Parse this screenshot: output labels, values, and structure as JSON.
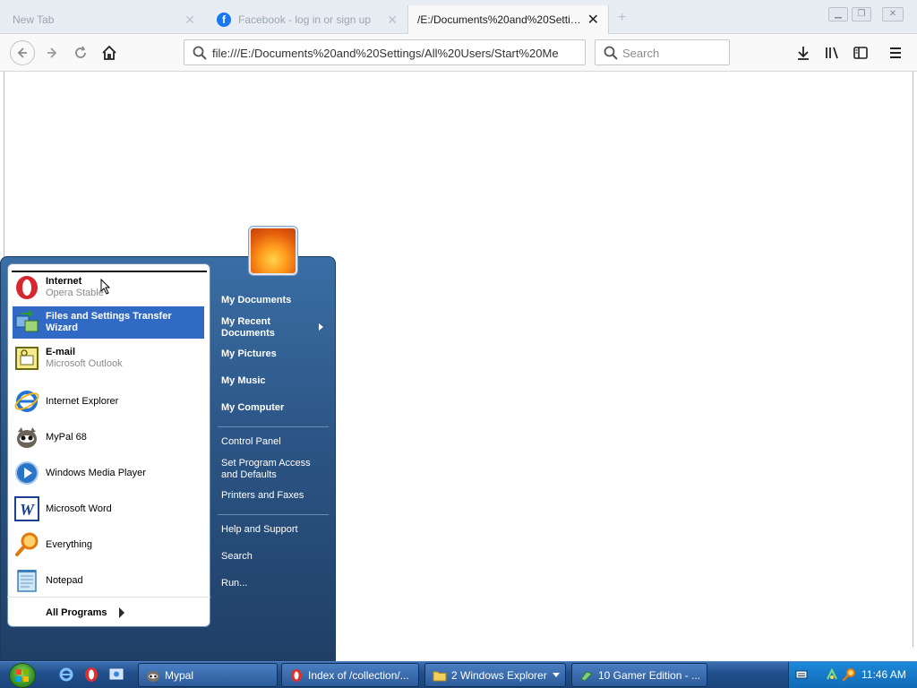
{
  "browser": {
    "tabs": [
      {
        "label": "New Tab",
        "active": false
      },
      {
        "label": "Facebook - log in or sign up",
        "active": false,
        "icon": "facebook-icon"
      },
      {
        "label": "/E:/Documents%20and%20Settings/A",
        "active": true
      }
    ],
    "url": "file:///E:/Documents%20and%20Settings/All%20Users/Start%20Me",
    "search_placeholder": "Search"
  },
  "start_menu": {
    "left_items": [
      {
        "title": "Internet",
        "subtitle": "Opera Stable",
        "bold": true,
        "icon": "opera-icon"
      },
      {
        "title": "Files and Settings Transfer Wizard",
        "subtitle": "",
        "bold": true,
        "selected": true,
        "icon": "transfer-wizard-icon"
      },
      {
        "title": "E-mail",
        "subtitle": "Microsoft Outlook",
        "bold": true,
        "icon": "outlook-icon"
      },
      {
        "title": "Internet Explorer",
        "subtitle": "",
        "icon": "internet-explorer-icon"
      },
      {
        "title": "MyPal 68",
        "subtitle": "",
        "icon": "mypal-icon"
      },
      {
        "title": "Windows Media Player",
        "subtitle": "",
        "icon": "media-player-icon"
      },
      {
        "title": "Microsoft Word",
        "subtitle": "",
        "icon": "word-icon"
      },
      {
        "title": "Everything",
        "subtitle": "",
        "icon": "everything-search-icon"
      },
      {
        "title": "Notepad",
        "subtitle": "",
        "icon": "notepad-icon"
      }
    ],
    "all_programs": "All Programs",
    "right_items": [
      {
        "label": "My Documents",
        "bold": true
      },
      {
        "label": "My Recent\nDocuments",
        "bold": true
      },
      {
        "label": "My Pictures",
        "bold": true
      },
      {
        "label": "My Music",
        "bold": true
      },
      {
        "label": "My Computer",
        "bold": true
      },
      {
        "label": "Control Panel",
        "bold": false
      },
      {
        "label": "Set Program Access\nand Defaults",
        "bold": false
      },
      {
        "label": "Printers and Faxes",
        "bold": false
      },
      {
        "label": "Help and Support",
        "bold": false
      },
      {
        "label": "Search",
        "bold": false
      },
      {
        "label": "Run...",
        "bold": false
      }
    ]
  },
  "taskbar": {
    "buttons": [
      {
        "label": "Mypal",
        "icon": "mypal-icon"
      },
      {
        "label": "Index of /collection/...",
        "icon": "opera-icon"
      },
      {
        "label": "2 Windows Explorer",
        "icon": "folder-icon"
      },
      {
        "label": "10 Gamer Edition - ...",
        "icon": "app-icon"
      }
    ],
    "clock": "11:46 AM"
  }
}
